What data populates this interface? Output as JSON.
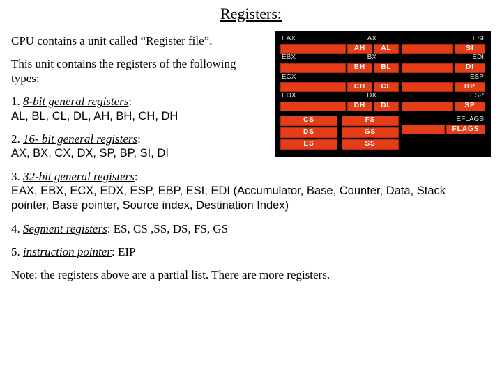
{
  "title": "Registers:",
  "p1": "CPU contains a unit called “Register file”.",
  "p2": "This unit contains the registers of the following types:",
  "items": [
    {
      "n": "1.",
      "head": "8-bit general registers",
      "tail": ":",
      "body": "AL, BL, CL, DL, AH, BH, CH, DH",
      "sans": true
    },
    {
      "n": "2.",
      "head": "16- bit general registers",
      "tail": ":",
      "body": "AX, BX, CX, DX, SP, BP, SI, DI",
      "sans": true
    },
    {
      "n": "3.",
      "head": "32-bit general registers",
      "tail": ":",
      "body": "EAX, EBX, ECX, EDX, ESP, EBP, ESI, EDI (Accumulator, Base, Counter, Data, Stack pointer, Base pointer, Source index, Destination Index)",
      "sans": true
    },
    {
      "n": "4.",
      "head": "Segment registers",
      "tail": ": ES, CS ,SS, DS, FS, GS",
      "body": "",
      "sans": false
    },
    {
      "n": "5.",
      "head": "instruction pointer",
      "tail": ": EIP",
      "body": "",
      "sans": false
    }
  ],
  "note": "Note: the registers above are a partial list. There are more registers.",
  "diagram": {
    "gp": [
      {
        "e": "EAX",
        "x": "AX",
        "h": "AH",
        "l": "AL",
        "r": "ESI",
        "s": "SI"
      },
      {
        "e": "EBX",
        "x": "BX",
        "h": "BH",
        "l": "BL",
        "r": "EDI",
        "s": "DI"
      },
      {
        "e": "ECX",
        "x": "",
        "h": "CH",
        "l": "CL",
        "r": "EBP",
        "s": "BP"
      },
      {
        "e": "EDX",
        "x": "DX",
        "h": "DH",
        "l": "DL",
        "r": "ESP",
        "s": "SP"
      }
    ],
    "seg": [
      [
        "CS",
        "FS"
      ],
      [
        "DS",
        "GS"
      ],
      [
        "ES",
        "SS"
      ]
    ],
    "eflags_label": "EFLAGS",
    "eflags": "FLAGS"
  }
}
